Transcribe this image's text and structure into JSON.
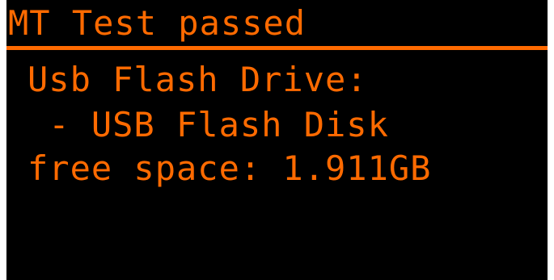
{
  "title": "MT Test passed",
  "lines": [
    "Usb Flash Drive:",
    " - USB Flash Disk",
    "free space: 1.911GB"
  ],
  "colors": {
    "foreground": "#ff6a00",
    "background": "#000000"
  }
}
